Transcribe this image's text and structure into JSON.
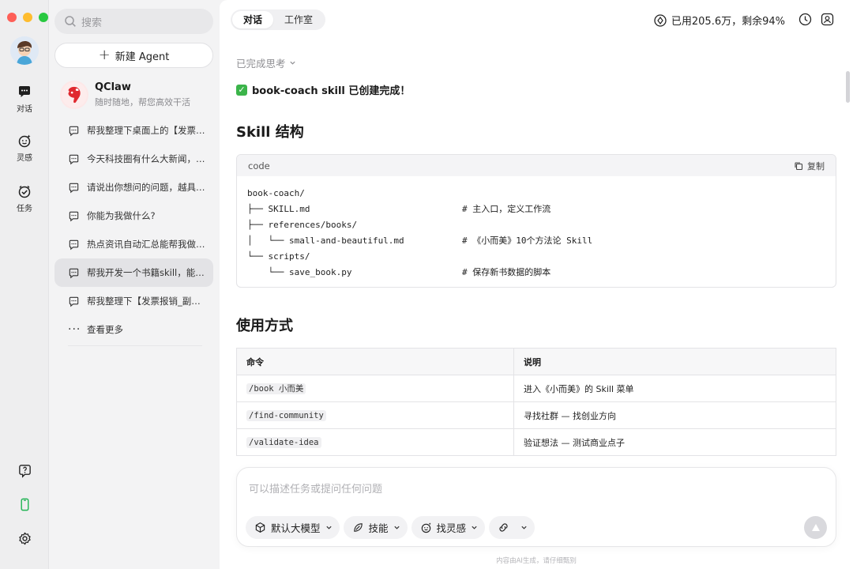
{
  "rail": {
    "items": [
      {
        "label": "对话"
      },
      {
        "label": "灵感"
      },
      {
        "label": "任务"
      }
    ]
  },
  "sidebar": {
    "search_placeholder": "搜索",
    "new_agent_label": "新建 Agent",
    "agent": {
      "name": "QClaw",
      "desc": "随时随地，帮您高效干活"
    },
    "conversations": [
      {
        "title": "帮我整理下桌面上的【发票报销"
      },
      {
        "title": "今天科技圈有什么大新闻，帮我"
      },
      {
        "title": "请说出你想问的问题，越具体越"
      },
      {
        "title": "你能为我做什么?"
      },
      {
        "title": "热点资讯自动汇总能帮我做什么"
      },
      {
        "title": "帮我开发一个书籍skill，能帮我"
      },
      {
        "title": "帮我整理下【发票报销_副本】"
      }
    ],
    "active_index": 5,
    "more_label": "查看更多"
  },
  "header": {
    "tabs": [
      {
        "label": "对话"
      },
      {
        "label": "工作室"
      }
    ],
    "quota": "已用205.6万，剩余94%"
  },
  "message": {
    "thinking": "已完成思考",
    "done": "book-coach skill 已创建完成！",
    "section1": "Skill 结构",
    "code_lang": "code",
    "copy_label": "复制",
    "code_lines": [
      {
        "path": "book-coach/",
        "comment": ""
      },
      {
        "path": "├── SKILL.md",
        "comment": "# 主入口，定义工作流"
      },
      {
        "path": "├── references/books/",
        "comment": ""
      },
      {
        "path": "│   └── small-and-beautiful.md",
        "comment": "# 《小而美》10个方法论 Skill"
      },
      {
        "path": "└── scripts/",
        "comment": ""
      },
      {
        "path": "    └── save_book.py",
        "comment": "# 保存新书数据的脚本"
      }
    ],
    "section2": "使用方式",
    "table": {
      "headers": [
        "命令",
        "说明"
      ],
      "rows": [
        {
          "cmd": "/book 小而美",
          "desc": "进入《小而美》的 Skill 菜单"
        },
        {
          "cmd": "/find-community",
          "desc": "寻找社群 — 找创业方向"
        },
        {
          "cmd": "/validate-idea",
          "desc": "验证想法 — 测试商业点子"
        }
      ]
    }
  },
  "composer": {
    "placeholder": "可以描述任务或提问任何问题",
    "chips": [
      {
        "label": "默认大模型"
      },
      {
        "label": "技能"
      },
      {
        "label": "找灵感"
      }
    ]
  },
  "footer_note": "内容由AI生成，请仔细甄别",
  "colors": {
    "accent_green": "#3bb44a",
    "traffic_red": "#fe5f57",
    "traffic_yellow": "#febc2e",
    "traffic_green": "#28c840"
  }
}
